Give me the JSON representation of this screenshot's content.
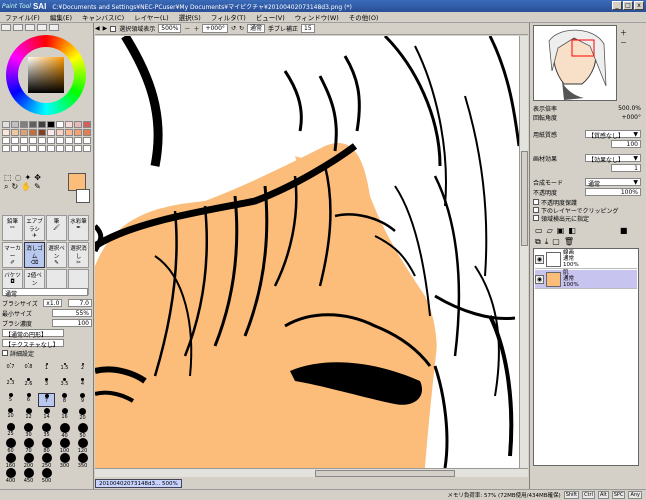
{
  "window": {
    "logo_small": "Paint Tool",
    "logo": "SAI",
    "title": "C:¥Documents and Settings¥NEC-PCuser¥My Documents¥マイピクチャ¥20100402073148d3.png (*)",
    "minimize": "_",
    "maximize": "□",
    "close": "x"
  },
  "menu": [
    "ファイル(F)",
    "編集(E)",
    "キャンバス(C)",
    "レイヤー(L)",
    "選択(S)",
    "フィルタ(T)",
    "ビュー(V)",
    "ウィンドウ(W)",
    "その他(O)"
  ],
  "canvas_toolbar": {
    "selection_show": "選択領域表示",
    "zoom": "500%",
    "rotation": "+000°",
    "mode": "通常",
    "stabilizer_label": "手ブレ補正",
    "stabilizer": "15"
  },
  "tools": [
    {
      "label": "鉛筆"
    },
    {
      "label": "エアブラシ"
    },
    {
      "label": "筆"
    },
    {
      "label": "水彩筆"
    },
    {
      "label": "マーカー"
    },
    {
      "label": "消しゴム"
    },
    {
      "label": "選択ペン"
    },
    {
      "label": "選択消し"
    },
    {
      "label": "バケツ"
    },
    {
      "label": "2値ペン"
    },
    {
      "label": "",
      "sel": false
    },
    {
      "label": ""
    }
  ],
  "tool_props": {
    "mode_label": "通常",
    "brush_size_label": "ブラシサイズ",
    "brush_size_mult": "x1.0",
    "brush_size": "7.0",
    "min_size_label": "最小サイズ",
    "min_size": "55%",
    "density_label": "ブラシ濃度",
    "density": "100",
    "shape": "【通常の円形】",
    "texture": "【テクスチャなし】",
    "detail": "詳細設定"
  },
  "brush_sizes": [
    "0.7",
    "0.8",
    "1",
    "1.5",
    "2",
    "2.3",
    "2.6",
    "3",
    "3.5",
    "4",
    "5",
    "6",
    "7",
    "8",
    "9",
    "10",
    "12",
    "14",
    "16",
    "20",
    "25",
    "30",
    "35",
    "40",
    "50",
    "60",
    "70",
    "80",
    "100",
    "120",
    "160",
    "200",
    "250",
    "300",
    "350",
    "400",
    "450",
    "500"
  ],
  "selected_brush_size": "7",
  "right_panel": {
    "zoom_label": "表示倍率",
    "zoom": "500.0%",
    "rotate_label": "回転角度",
    "rotate": "+000°",
    "paper_label": "用紙質感",
    "paper": "【質感なし】",
    "paper_value": "100",
    "effect_label": "画材効果",
    "effect": "【効果なし】",
    "effect_value": "1",
    "blend_label": "合成モード",
    "blend": "通常",
    "opacity_label": "不透明度",
    "opacity": "100%",
    "protect": "不透明度保護",
    "clip": "下のレイヤーでクリッピング",
    "ref": "領域検出元に指定"
  },
  "layers": [
    {
      "name": "線画",
      "mode": "通常",
      "opacity": "100%",
      "selected": false
    },
    {
      "name": "肌",
      "mode": "通常",
      "opacity": "100%",
      "selected": true
    }
  ],
  "document_tab": {
    "name": "20100402073148d3...",
    "zoom": "500%"
  },
  "status": {
    "memory": "メモリ負荷率: 57% (72MB使用/434MB確保)",
    "keys": [
      "Shift",
      "Ctrl",
      "Alt",
      "SPC",
      "Any"
    ]
  },
  "colors": {
    "skin": "#fcbd7a",
    "primary_color": "#fcbd7a",
    "title_blue": "#2a4f98"
  }
}
